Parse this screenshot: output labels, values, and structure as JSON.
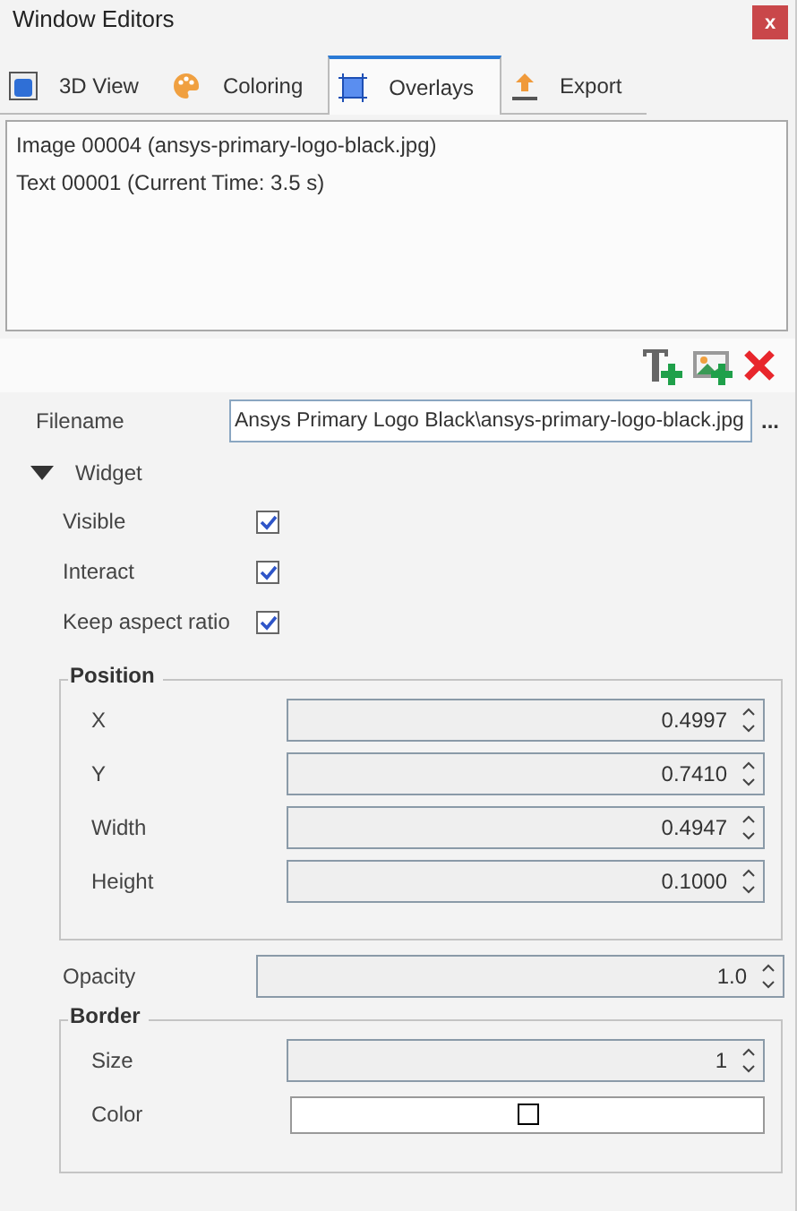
{
  "window": {
    "title": "Window Editors",
    "close": "x"
  },
  "tabs": [
    {
      "label": "3D View",
      "selected": false
    },
    {
      "label": "Coloring",
      "selected": false
    },
    {
      "label": "Overlays",
      "selected": true
    },
    {
      "label": "Export",
      "selected": false
    }
  ],
  "overlays": [
    {
      "label": "Image 00004 (ansys-primary-logo-black.jpg)",
      "selected": false
    },
    {
      "label": "Text 00001 (Current Time: 3.5 s)",
      "selected": false
    }
  ],
  "filename": {
    "label": "Filename",
    "value": "Ansys Primary Logo Black\\ansys-primary-logo-black.jpg",
    "browse": "..."
  },
  "widget": {
    "label": "Widget",
    "expanded": true,
    "checks": [
      {
        "label": "Visible",
        "checked": true
      },
      {
        "label": "Interact",
        "checked": true
      },
      {
        "label": "Keep aspect ratio",
        "checked": true
      }
    ]
  },
  "position": {
    "title": "Position",
    "fields": [
      {
        "label": "X",
        "value": "0.4997"
      },
      {
        "label": "Y",
        "value": "0.7410"
      },
      {
        "label": "Width",
        "value": "0.4947"
      },
      {
        "label": "Height",
        "value": "0.1000"
      }
    ]
  },
  "opacity": {
    "label": "Opacity",
    "value": "1.0"
  },
  "border": {
    "title": "Border",
    "size": {
      "label": "Size",
      "value": "1"
    },
    "color": {
      "label": "Color",
      "color": "#ffffff"
    }
  }
}
